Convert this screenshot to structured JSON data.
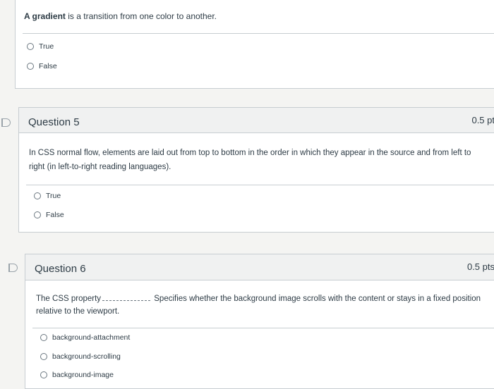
{
  "q4": {
    "text_bold": "A gradient",
    "text_rest": " is a transition from one color to another.",
    "options": [
      "True",
      "False"
    ]
  },
  "q5": {
    "title": "Question 5",
    "points": "0.5 pt",
    "text": "In CSS normal flow, elements are laid out from top to bottom in the order in which they appear in the source and from left to right (in left-to-right reading languages).",
    "options": [
      "True",
      "False"
    ]
  },
  "q6": {
    "title": "Question 6",
    "points": "0.5 pts",
    "text_a": "The CSS property",
    "text_b": "Specifies whether the background image scrolls with the content or stays in a fixed position relative to the viewport.",
    "text_line2": "relative to the viewport.",
    "text_b_line1": "Specifies whether the background image scrolls with the content or stays in a fixed position",
    "options": [
      "background-attachment",
      "background-scrolling",
      "background-image"
    ]
  }
}
